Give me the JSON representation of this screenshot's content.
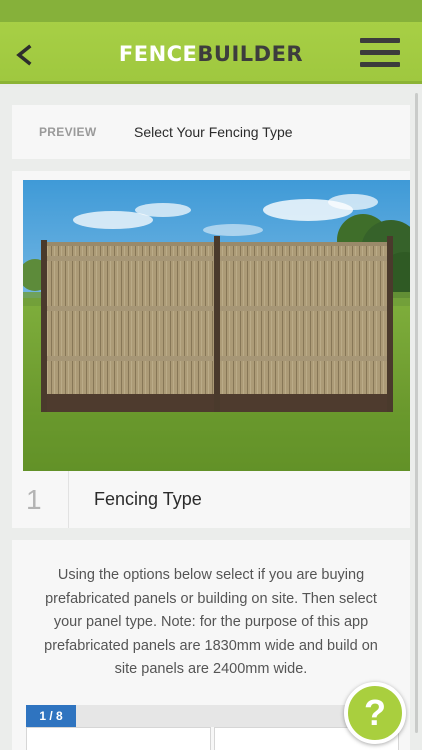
{
  "header": {
    "logo_part1": "FENCE",
    "logo_part2": "BUILDER",
    "brand_color": "#a3cc42"
  },
  "breadcrumb": {
    "preview_label": "PREVIEW",
    "title": "Select Your Fencing Type"
  },
  "step": {
    "number": "1",
    "title": "Fencing Type"
  },
  "info": {
    "text": "Using the options below select if you are buying prefabricated panels or building on site.  Then select your panel type.  Note: for the purpose of this app prefabricated panels are 1830mm wide and build on site panels are 2400mm wide."
  },
  "pager": {
    "counter": "1 / 8"
  },
  "help": {
    "label": "?"
  },
  "icons": {
    "back": "chevron-left-icon",
    "menu": "hamburger-menu-icon",
    "help": "question-mark-icon"
  }
}
